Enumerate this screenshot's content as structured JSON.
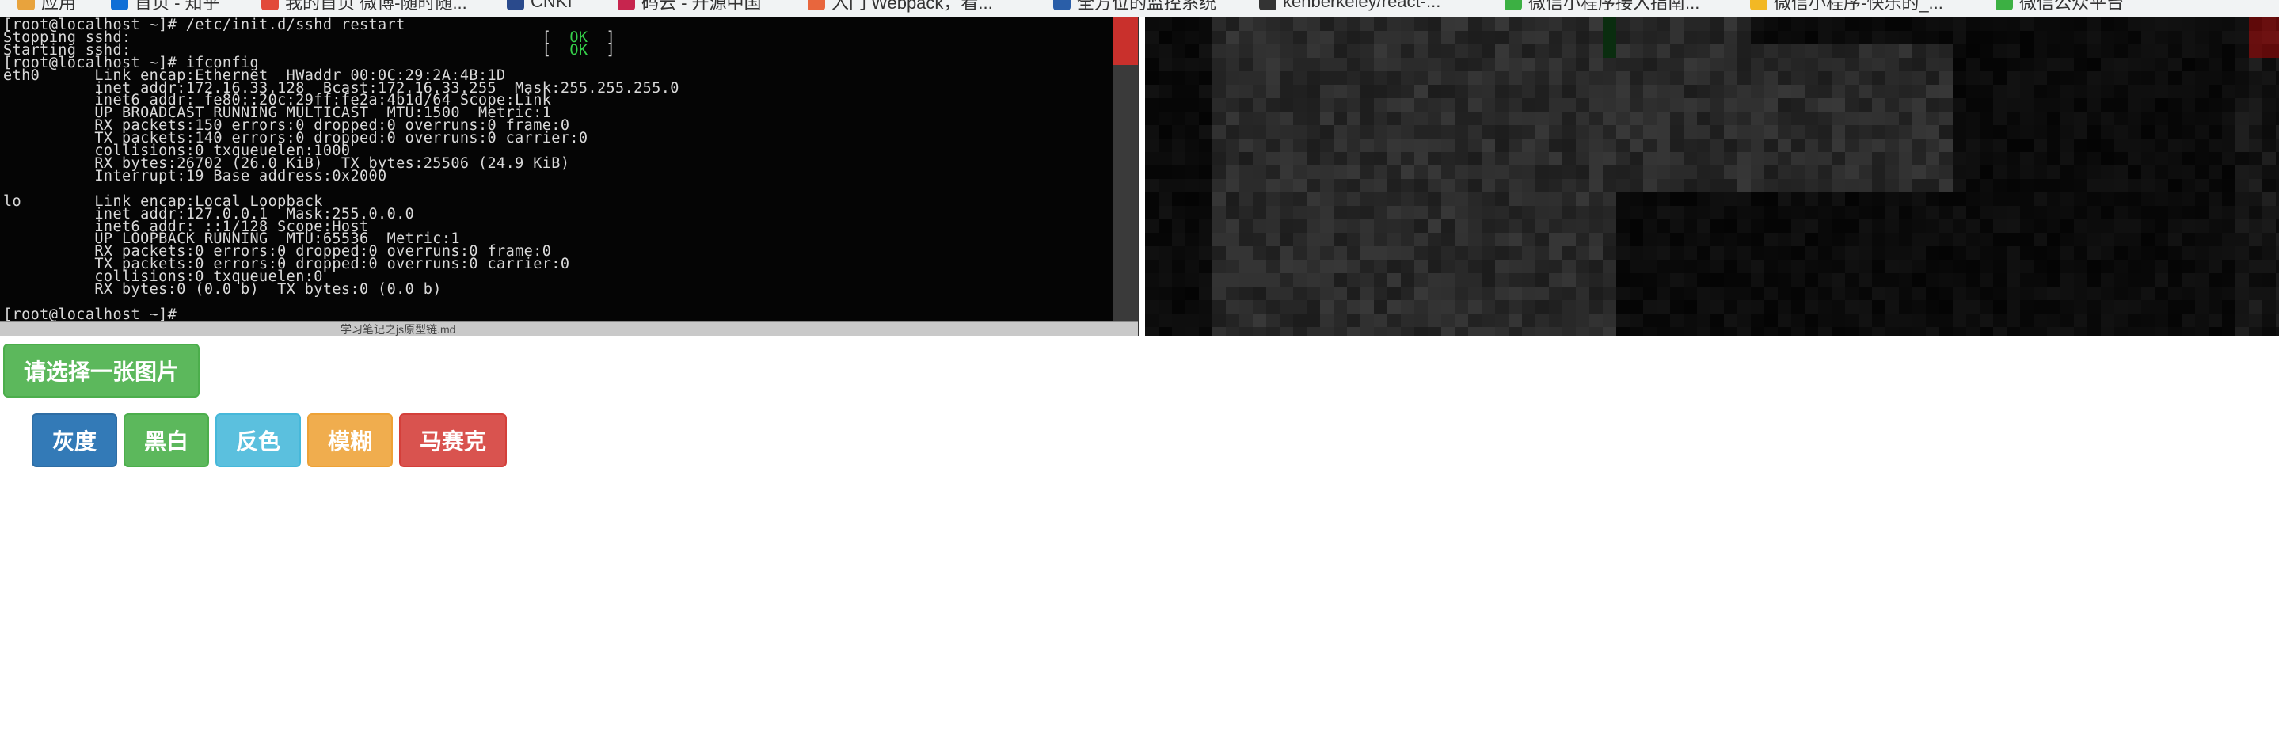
{
  "bookmarks": [
    {
      "label": "应用",
      "color": "#e8a33d"
    },
    {
      "label": "首页 - 知乎",
      "color": "#0e6ed6"
    },
    {
      "label": "我的首页 微博-随时随...",
      "color": "#e24a3a"
    },
    {
      "label": "CNKI",
      "color": "#2a4a8c"
    },
    {
      "label": "码云 - 开源中国",
      "color": "#c7254e"
    },
    {
      "label": "入门 Webpack，看...",
      "color": "#e8663d"
    },
    {
      "label": "全方位的监控系统",
      "color": "#2a5ea8"
    },
    {
      "label": "kenberkeley/react-...",
      "color": "#333333"
    },
    {
      "label": "微信小程序接入指南...",
      "color": "#3cb043"
    },
    {
      "label": "微信小程序-快乐的_...",
      "color": "#f2b824"
    },
    {
      "label": "微信公众平台",
      "color": "#3cb043"
    }
  ],
  "terminal": {
    "lines": [
      "[root@localhost ~]# /etc/init.d/sshd restart",
      "Stopping sshd:                                             [  OK  ]",
      "Starting sshd:                                             [  OK  ]",
      "[root@localhost ~]# ifconfig",
      "eth0      Link encap:Ethernet  HWaddr 00:0C:29:2A:4B:1D",
      "          inet addr:172.16.33.128  Bcast:172.16.33.255  Mask:255.255.255.0",
      "          inet6 addr: fe80::20c:29ff:fe2a:4b1d/64 Scope:Link",
      "          UP BROADCAST RUNNING MULTICAST  MTU:1500  Metric:1",
      "          RX packets:150 errors:0 dropped:0 overruns:0 frame:0",
      "          TX packets:140 errors:0 dropped:0 overruns:0 carrier:0",
      "          collisions:0 txqueuelen:1000",
      "          RX bytes:26702 (26.0 KiB)  TX bytes:25506 (24.9 KiB)",
      "          Interrupt:19 Base address:0x2000",
      "",
      "lo        Link encap:Local Loopback",
      "          inet addr:127.0.0.1  Mask:255.0.0.0",
      "          inet6 addr: ::1/128 Scope:Host",
      "          UP LOOPBACK RUNNING  MTU:65536  Metric:1",
      "          RX packets:0 errors:0 dropped:0 overruns:0 frame:0",
      "          TX packets:0 errors:0 dropped:0 overruns:0 carrier:0",
      "          collisions:0 txqueuelen:0",
      "          RX bytes:0 (0.0 b)  TX bytes:0 (0.0 b)",
      "",
      "[root@localhost ~]# _"
    ],
    "taskbar_text": "学习笔记之js原型链.md"
  },
  "buttons": {
    "choose_image": "请选择一张图片",
    "grayscale": "灰度",
    "black_white": "黑白",
    "invert": "反色",
    "blur": "模糊",
    "mosaic": "马赛克"
  },
  "colors": {
    "primary": "#337ab7",
    "success": "#5cb85c",
    "info": "#5bc0de",
    "warning": "#f0ad4e",
    "danger": "#d9534f"
  }
}
